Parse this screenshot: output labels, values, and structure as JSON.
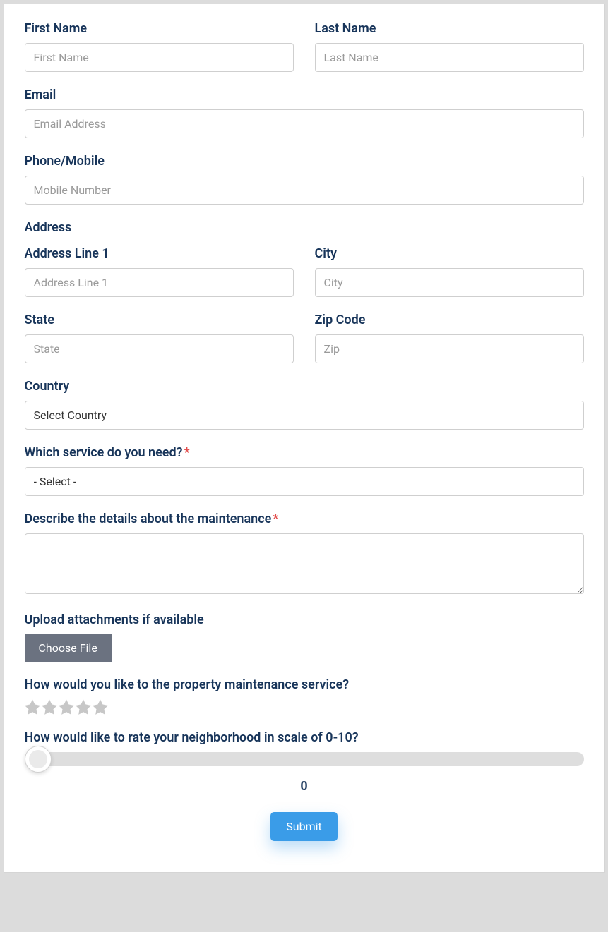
{
  "firstName": {
    "label": "First Name",
    "placeholder": "First Name"
  },
  "lastName": {
    "label": "Last Name",
    "placeholder": "Last Name"
  },
  "email": {
    "label": "Email",
    "placeholder": "Email Address"
  },
  "phone": {
    "label": "Phone/Mobile",
    "placeholder": "Mobile Number"
  },
  "address": {
    "sectionLabel": "Address",
    "line1": {
      "label": "Address Line 1",
      "placeholder": "Address Line 1"
    },
    "city": {
      "label": "City",
      "placeholder": "City"
    },
    "state": {
      "label": "State",
      "placeholder": "State"
    },
    "zip": {
      "label": "Zip Code",
      "placeholder": "Zip"
    },
    "country": {
      "label": "Country",
      "selected": "Select Country"
    }
  },
  "service": {
    "label": "Which service do you need?",
    "selected": "- Select -"
  },
  "details": {
    "label": "Describe the details about the maintenance"
  },
  "upload": {
    "label": "Upload attachments if available",
    "button": "Choose File"
  },
  "rating": {
    "label": "How would you like to the property maintenance service?"
  },
  "slider": {
    "label": "How would like to rate your neighborhood in scale of 0-10?",
    "value": "0"
  },
  "submit": {
    "label": "Submit"
  },
  "requiredMark": "*"
}
